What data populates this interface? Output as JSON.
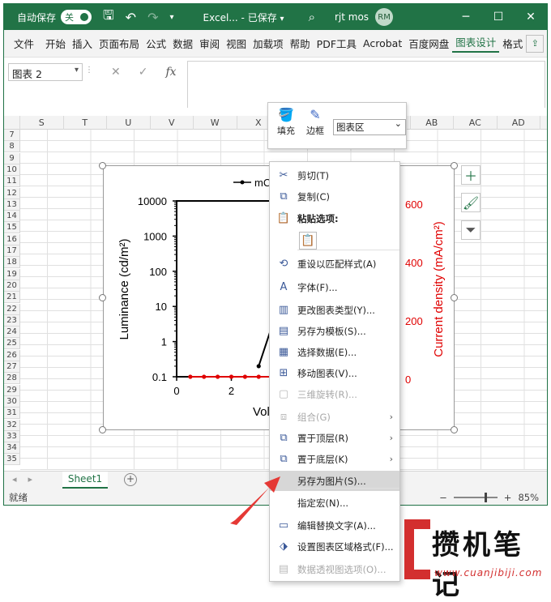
{
  "titlebar": {
    "autosave_label": "自动保存",
    "autosave_state": "关",
    "title": "Excel... - 已保存",
    "title_caret": "▾",
    "user_name": "rjt mos",
    "avatar_initials": "RM"
  },
  "ribbon": {
    "tabs": [
      "文件",
      "开始",
      "插入",
      "页面布局",
      "公式",
      "数据",
      "审阅",
      "视图",
      "加载项",
      "帮助",
      "PDF工具",
      "Acrobat",
      "百度网盘",
      "图表设计",
      "格式"
    ],
    "active_tab": "图表设计"
  },
  "formula_bar": {
    "name_box": "图表 2",
    "fx_label": "fx",
    "cancel_glyph": "✕",
    "enter_glyph": "✓"
  },
  "columns": [
    "S",
    "T",
    "U",
    "V",
    "W",
    "X",
    "Y",
    "Z",
    "AA",
    "AB",
    "AC",
    "AD"
  ],
  "rows": [
    "7",
    "8",
    "9",
    "10",
    "11",
    "12",
    "13",
    "14",
    "15",
    "16",
    "17",
    "18",
    "19",
    "20",
    "21",
    "22",
    "23",
    "24",
    "25",
    "26",
    "27",
    "28",
    "29",
    "30",
    "31",
    "32",
    "33",
    "34",
    "35"
  ],
  "chart": {
    "legend_text": "mCE",
    "left_axis_label": "Luminance (cd/m²)",
    "right_axis_label": "Current density (mA/cm²)",
    "x_axis_label": "Vol",
    "left_ticks": [
      "10000",
      "1000",
      "100",
      "10",
      "1",
      "0.1"
    ],
    "right_ticks": [
      "600",
      "400",
      "200",
      "0"
    ],
    "x_ticks": [
      "0",
      "2",
      "4",
      "6"
    ],
    "right_axis_color": "#e00000",
    "series": [
      {
        "color": "#000000",
        "x": [
          3.0,
          3.5,
          4.0,
          4.5,
          5.0,
          5.5,
          6.0
        ],
        "y": [
          0.2,
          3,
          40,
          180,
          500,
          1000,
          1800
        ]
      },
      {
        "color": "#e00000",
        "x": [
          0.5,
          1.0,
          1.5,
          2.0,
          2.5,
          3.0,
          3.5,
          4.0,
          4.5,
          5.0,
          5.5,
          6.0
        ],
        "y": [
          0.1,
          0.1,
          0.1,
          0.1,
          0.1,
          0.1,
          0.1,
          0.1,
          0.1,
          0.12,
          0.15,
          0.2
        ]
      }
    ]
  },
  "mini_toolbar": {
    "fill_label": "填充",
    "border_label": "边框",
    "area_select": "图表区"
  },
  "context_menu": {
    "items": [
      {
        "label": "剪切(T)",
        "icon": "scissors-icon",
        "enabled": true
      },
      {
        "label": "复制(C)",
        "icon": "copy-icon",
        "enabled": true
      },
      {
        "label": "粘贴选项:",
        "icon": "paste-icon",
        "enabled": true
      },
      {
        "label": "重设以匹配样式(A)",
        "icon": "reset-style-icon",
        "enabled": true
      },
      {
        "label": "字体(F)...",
        "icon": "font-icon",
        "enabled": true
      },
      {
        "label": "更改图表类型(Y)...",
        "icon": "chart-type-icon",
        "enabled": true
      },
      {
        "label": "另存为模板(S)...",
        "icon": "template-icon",
        "enabled": true
      },
      {
        "label": "选择数据(E)...",
        "icon": "select-data-icon",
        "enabled": true
      },
      {
        "label": "移动图表(V)...",
        "icon": "move-chart-icon",
        "enabled": true
      },
      {
        "label": "三维旋转(R)...",
        "icon": "3d-rotate-icon",
        "enabled": false
      },
      {
        "label": "组合(G)",
        "icon": "group-icon",
        "enabled": false
      },
      {
        "label": "置于顶层(R)",
        "icon": "bring-front-icon",
        "enabled": true
      },
      {
        "label": "置于底层(K)",
        "icon": "send-back-icon",
        "enabled": true
      },
      {
        "label": "另存为图片(S)...",
        "icon": "",
        "enabled": true
      },
      {
        "label": "指定宏(N)...",
        "icon": "",
        "enabled": true
      },
      {
        "label": "编辑替换文字(A)...",
        "icon": "alt-text-icon",
        "enabled": true
      },
      {
        "label": "设置图表区域格式(F)...",
        "icon": "format-area-icon",
        "enabled": true
      },
      {
        "label": "数据透视图选项(O)...",
        "icon": "pivot-options-icon",
        "enabled": false
      }
    ]
  },
  "sheet_tabs": {
    "active": "Sheet1",
    "add": "+"
  },
  "status": {
    "ready": "就绪",
    "zoom": "85%"
  },
  "watermark": {
    "text": "攒机笔记",
    "url": "www.cuanjibiji.com"
  }
}
